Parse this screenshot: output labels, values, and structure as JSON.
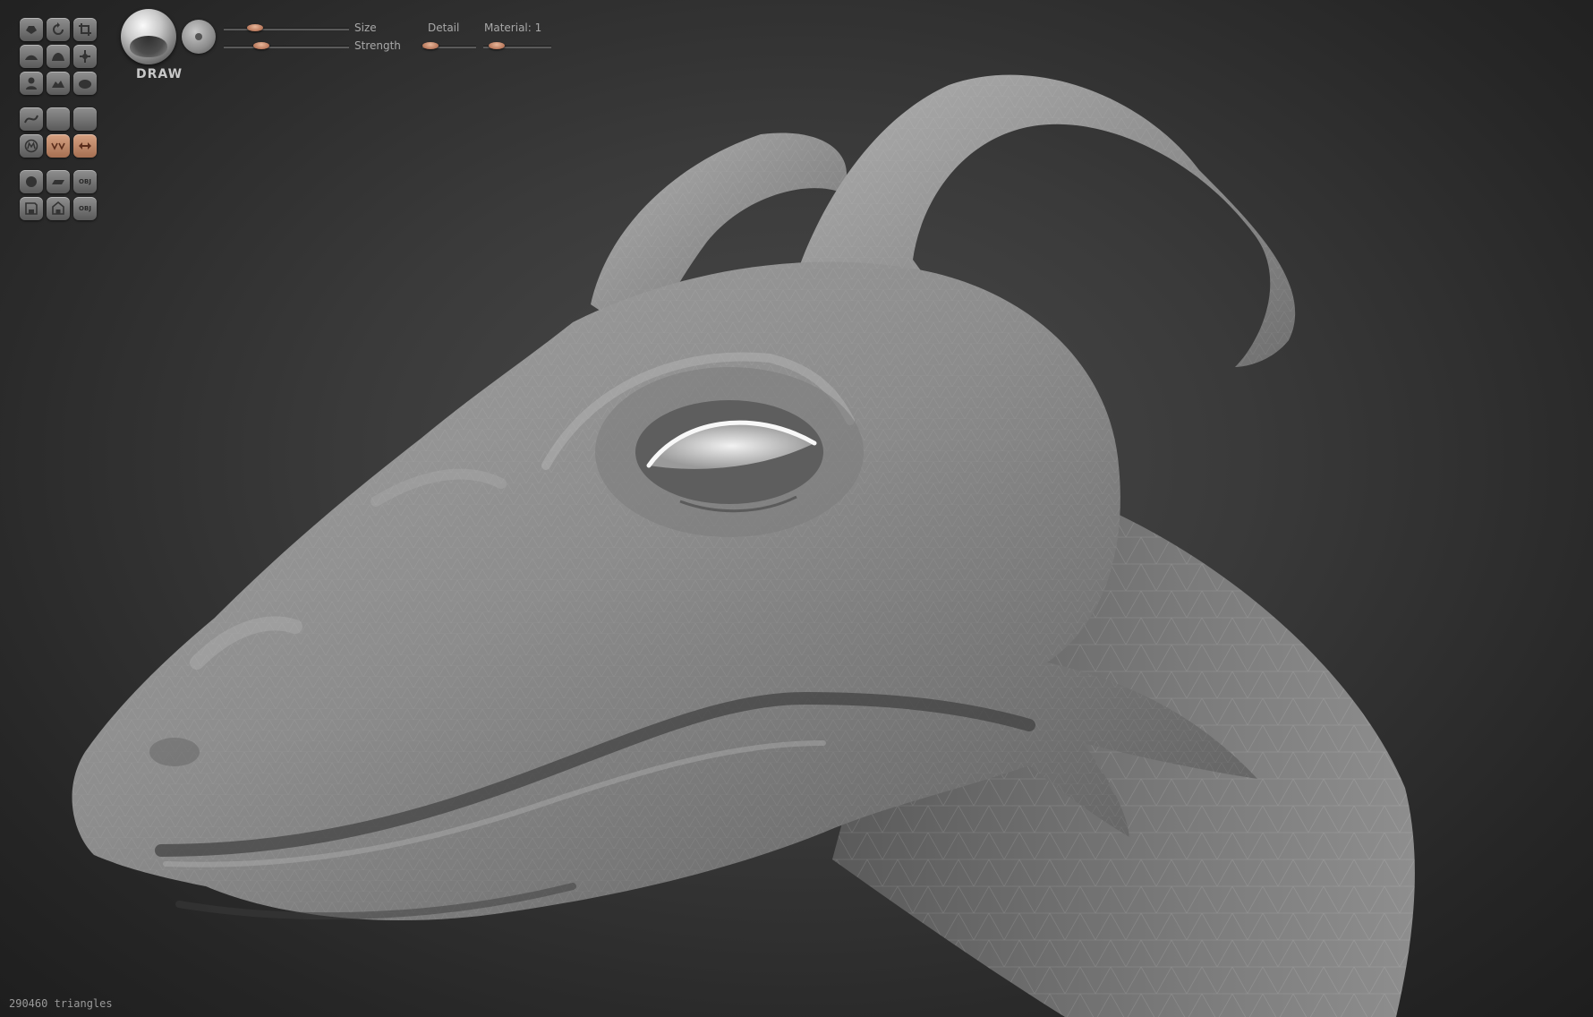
{
  "toolbar": {
    "brush_name": "DRAW",
    "size_label": "Size",
    "strength_label": "Strength",
    "detail_label": "Detail",
    "material_label": "Material: 1",
    "size_value": 0.25,
    "strength_value": 0.3,
    "detail_value": 0.15,
    "material_value": 0.2
  },
  "tools": {
    "rows": [
      [
        "cursor-icon",
        "rotate-icon",
        "crop-icon"
      ],
      [
        "brush-icon",
        "inflate-icon",
        "move-icon"
      ],
      [
        "person-icon",
        "smooth-icon",
        "blob-icon"
      ],
      [
        "curve-icon",
        "blank-icon",
        "blank-icon"
      ],
      [
        "mask-icon",
        "symmetry-icon",
        "mirror-icon"
      ],
      [
        "sphere-icon",
        "plane-icon",
        "import-obj-icon"
      ],
      [
        "save-icon",
        "save-as-icon",
        "export-obj-icon"
      ]
    ],
    "obj_text": "OBJ",
    "active": [
      "symmetry-icon",
      "mirror-icon"
    ]
  },
  "status": {
    "triangles": "290460 triangles"
  },
  "colors": {
    "accent": "#c48a6c",
    "background": "#2e2e2e",
    "mesh": "#8a8a8a"
  }
}
